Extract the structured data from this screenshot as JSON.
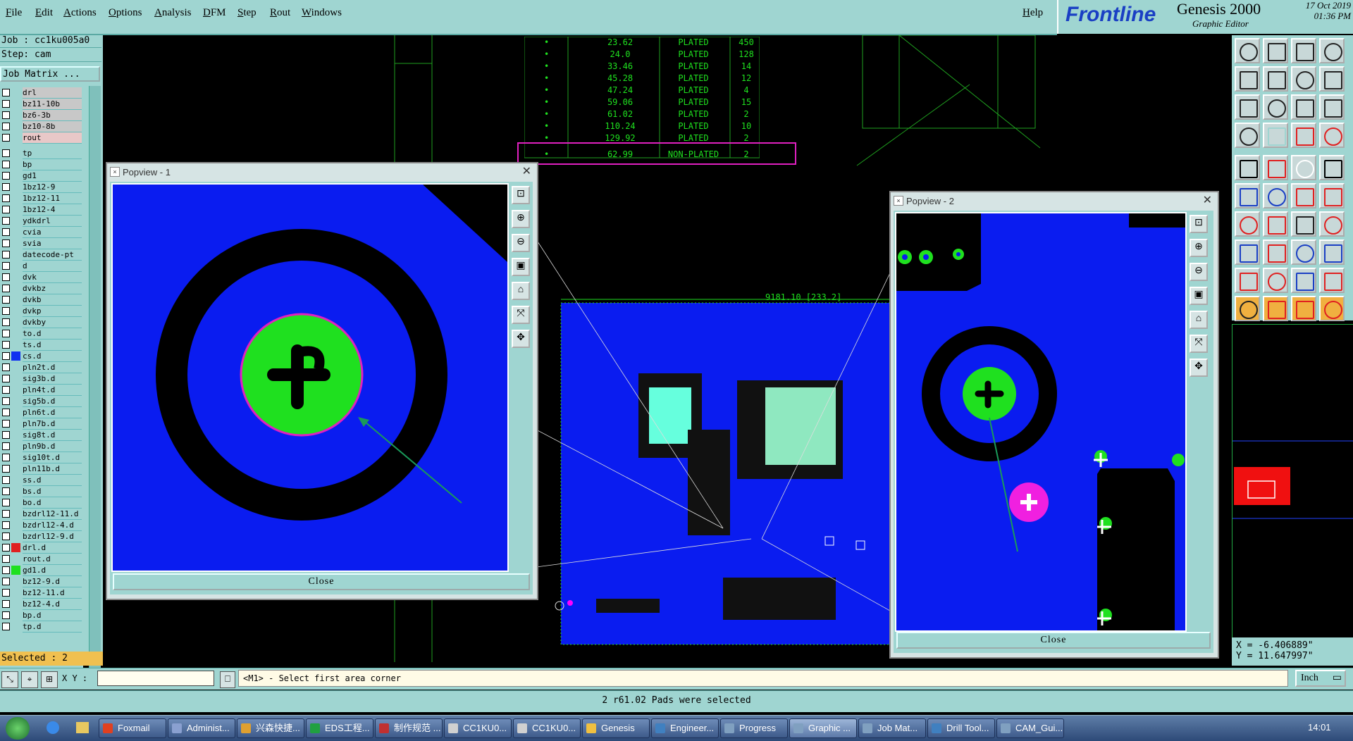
{
  "menu": {
    "items": [
      "File",
      "Edit",
      "Actions",
      "Options",
      "Analysis",
      "DFM",
      "Step",
      "Rout",
      "Windows"
    ],
    "help": "Help"
  },
  "logo": {
    "brand": "Frontline",
    "product": "Genesis 2000",
    "subtitle": "Graphic Editor",
    "date": "17 Oct 2019",
    "time": "01:36 PM"
  },
  "left_panel": {
    "job": "Job : cc1ku005a0",
    "step": "Step: cam",
    "matrix_button": "Job Matrix ...",
    "layers": [
      "drl",
      "bz11-10b",
      "bz6-3b",
      "bz10-8b",
      "rout",
      "tp",
      "bp",
      "gd1",
      "1bz12-9",
      "1bz12-11",
      "1bz12-4",
      "ydkdrl",
      "cvia",
      "svia",
      "datecode-pt",
      "d",
      "dvk",
      "dvkbz",
      "dvkb",
      "dvkp",
      "dvkby",
      "to.d",
      "ts.d",
      "cs.d",
      "pln2t.d",
      "sig3b.d",
      "pln4t.d",
      "sig5b.d",
      "pln6t.d",
      "pln7b.d",
      "sig8t.d",
      "pln9b.d",
      "sig10t.d",
      "pln11b.d",
      "ss.d",
      "bs.d",
      "bo.d",
      "bzdrl12-11.d",
      "bzdrl12-4.d",
      "bzdrl12-9.d",
      "drl.d",
      "rout.d",
      "gd1.d",
      "bz12-9.d",
      "bz12-11.d",
      "bz12-4.d",
      "bp.d",
      "tp.d"
    ],
    "selected": "Selected : 2"
  },
  "drill_table": {
    "rows": [
      {
        "size": "23.62",
        "type": "PLATED",
        "count": "450"
      },
      {
        "size": "24.0",
        "type": "PLATED",
        "count": "128"
      },
      {
        "size": "33.46",
        "type": "PLATED",
        "count": "14"
      },
      {
        "size": "45.28",
        "type": "PLATED",
        "count": "12"
      },
      {
        "size": "47.24",
        "type": "PLATED",
        "count": "4"
      },
      {
        "size": "59.06",
        "type": "PLATED",
        "count": "15"
      },
      {
        "size": "61.02",
        "type": "PLATED",
        "count": "2"
      },
      {
        "size": "110.24",
        "type": "PLATED",
        "count": "10"
      },
      {
        "size": "129.92",
        "type": "PLATED",
        "count": "2"
      },
      {
        "size": "62.99",
        "type": "NON-PLATED",
        "count": "2"
      }
    ]
  },
  "board": {
    "dimension_label": "9181.10 [233.2]"
  },
  "popview1": {
    "title": "Popview - 1",
    "close": "Close"
  },
  "popview2": {
    "title": "Popview - 2",
    "close": "Close"
  },
  "coords": {
    "x": "X = -6.406889\"",
    "y": "Y = 11.647997\""
  },
  "command_bar": {
    "xy_label": "X Y :",
    "xy_value": "",
    "prompt": "<M1> - Select first area corner",
    "units": "Inch"
  },
  "status": "2 r61.02 Pads were selected",
  "taskbar": {
    "items": [
      "Foxmail",
      "Administ...",
      "兴森快捷...",
      "EDS工程...",
      "制作规范 ...",
      "CC1KU0...",
      "CC1KU0...",
      "Genesis",
      "Engineer...",
      "Progress",
      "Graphic ...",
      "Job Mat...",
      "Drill Tool...",
      "CAM_Gui..."
    ],
    "clock": "14:01"
  },
  "colors": {
    "panel": "#9fd5d1",
    "copper": "#0a1cf0",
    "drill": "#1fe01f",
    "highlight": "#ff00ff"
  }
}
